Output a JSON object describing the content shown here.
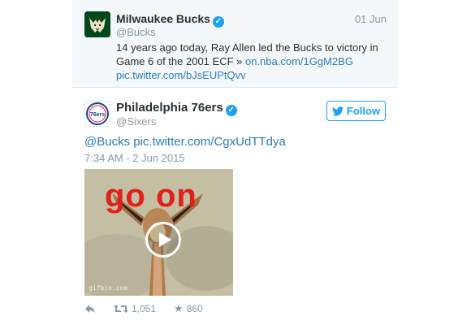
{
  "quoted_tweet": {
    "name": "Milwaukee Bucks",
    "handle": "@Bucks",
    "date": "01 Jun",
    "text": "14 years ago today, Ray Allen led the Bucks to victory in Game 6 of the 2001 ECF » ",
    "link1": "on.nba.com/1GgM2BG",
    "link2": "pic.twitter.com/bJsEUPtQvv",
    "avatar_icon": "bucks-logo-icon",
    "avatar_color": "#00471b"
  },
  "tweet": {
    "name": "Philadelphia 76ers",
    "handle": "@Sixers",
    "mention": "@Bucks",
    "link": "pic.twitter.com/CgxUdTTdya",
    "timestamp": "7:34 AM - 2 Jun 2015",
    "avatar_text": "76ers",
    "follow_label": "Follow",
    "media": {
      "caption": "go on",
      "watermark": "gifbin.com"
    },
    "retweets": "1,051",
    "favorites": "860"
  },
  "colors": {
    "link": "#2b7bb9",
    "accent": "#1da1f2",
    "muted": "#8899a6",
    "caption": "#e0201a"
  }
}
